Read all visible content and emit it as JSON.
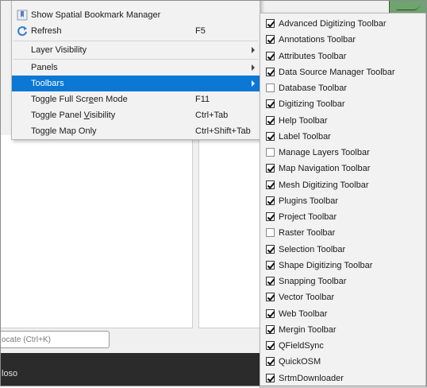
{
  "view_menu": {
    "items": [
      {
        "label": "Show Spatial Bookmark Manager",
        "shortcut": "",
        "icon": "bookmark-icon"
      },
      {
        "label": "Refresh",
        "shortcut": "F5",
        "icon": "refresh-icon"
      },
      {
        "label": "Layer Visibility",
        "shortcut": ""
      },
      {
        "label": "Panels",
        "shortcut": ""
      },
      {
        "label": "Toolbars",
        "shortcut": ""
      },
      {
        "label": "Toggle Full Screen Mode",
        "shortcut": "F11"
      },
      {
        "label": "Toggle Panel Visibility",
        "shortcut": "Ctrl+Tab"
      },
      {
        "label": "Toggle Map Only",
        "shortcut": "Ctrl+Shift+Tab"
      }
    ],
    "toggle_full_screen": {
      "pre": "Toggle Full Scr",
      "mnemonic": "e",
      "post": "en Mode"
    },
    "toggle_panel": {
      "pre": "Toggle Panel ",
      "mnemonic": "V",
      "post": "isibility"
    }
  },
  "toolbars_menu": {
    "items": [
      {
        "label": "Advanced Digitizing Toolbar",
        "checked": true
      },
      {
        "label": "Annotations Toolbar",
        "checked": true
      },
      {
        "label": "Attributes Toolbar",
        "checked": true
      },
      {
        "label": "Data Source Manager Toolbar",
        "checked": true
      },
      {
        "label": "Database Toolbar",
        "checked": false
      },
      {
        "label": "Digitizing Toolbar",
        "checked": true
      },
      {
        "label": "Help Toolbar",
        "checked": true
      },
      {
        "label": "Label Toolbar",
        "checked": true
      },
      {
        "label": "Manage Layers Toolbar",
        "checked": false
      },
      {
        "label": "Map Navigation Toolbar",
        "checked": true
      },
      {
        "label": "Mesh Digitizing Toolbar",
        "checked": true
      },
      {
        "label": "Plugins Toolbar",
        "checked": true
      },
      {
        "label": "Project Toolbar",
        "checked": true
      },
      {
        "label": "Raster Toolbar",
        "checked": false
      },
      {
        "label": "Selection Toolbar",
        "checked": true
      },
      {
        "label": "Shape Digitizing Toolbar",
        "checked": true
      },
      {
        "label": "Snapping Toolbar",
        "checked": true
      },
      {
        "label": "Vector Toolbar",
        "checked": true
      },
      {
        "label": "Web Toolbar",
        "checked": true
      },
      {
        "label": "Mergin Toolbar",
        "checked": true
      },
      {
        "label": "QFieldSync",
        "checked": true
      },
      {
        "label": "QuickOSM",
        "checked": true
      },
      {
        "label": "SrtmDownloader",
        "checked": true
      }
    ]
  },
  "locator": {
    "placeholder": "ocate (Ctrl+K)"
  },
  "statusbar": {
    "text": "loso"
  },
  "colors": {
    "highlight": "#0a78d4",
    "menu_bg": "#f2f2f2",
    "statusbar": "#2b2b2b"
  }
}
